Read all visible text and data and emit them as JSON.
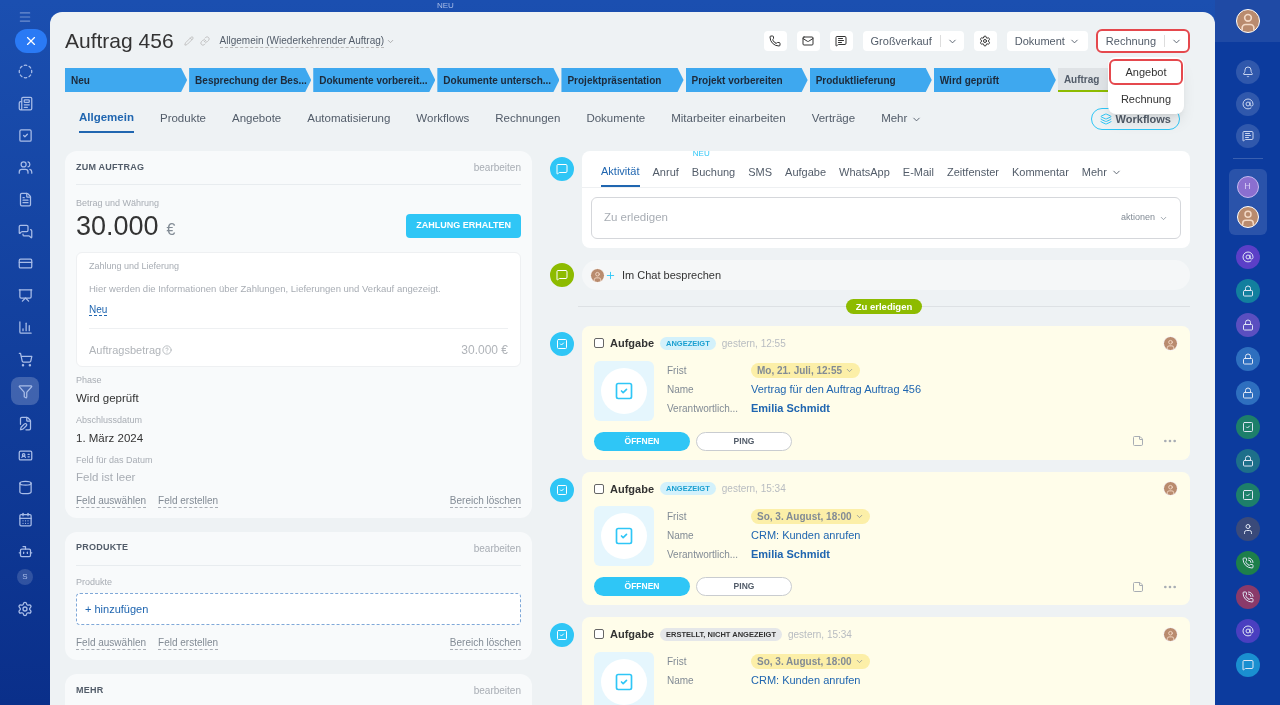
{
  "top_badge": "NEU",
  "left_nav": {
    "items": [
      {
        "selected": false
      },
      {
        "selected": false
      },
      {
        "selected": false
      },
      {
        "selected": false
      },
      {
        "selected": false
      },
      {
        "selected": false
      },
      {
        "selected": false
      },
      {
        "selected": false
      },
      {
        "selected": false
      },
      {
        "selected": false
      },
      {
        "selected": true
      },
      {
        "selected": false
      },
      {
        "selected": false
      },
      {
        "selected": false
      },
      {
        "selected": false
      },
      {
        "selected": false
      }
    ],
    "user_letter": "S"
  },
  "header": {
    "title": "Auftrag 456",
    "pipeline": "Allgemein (Wiederkehrender Auftrag)",
    "buttons": [
      {
        "kind": "phone"
      },
      {
        "kind": "mail"
      },
      {
        "kind": "chat"
      },
      {
        "kind": "split",
        "label": "Großverkauf",
        "highlighted": false
      },
      {
        "kind": "gear"
      },
      {
        "kind": "menu",
        "label": "Dokument",
        "highlighted": false
      },
      {
        "kind": "split",
        "label": "Rechnung",
        "highlighted": true
      }
    ]
  },
  "dropdown": {
    "items": [
      {
        "label": "Angebot",
        "highlighted": true
      },
      {
        "label": "Rechnung",
        "highlighted": false
      }
    ]
  },
  "stages": [
    {
      "label": "Neu",
      "active": true
    },
    {
      "label": "Besprechung der Bes...",
      "active": true
    },
    {
      "label": "Dokumente vorbereit...",
      "active": true
    },
    {
      "label": "Dokumente untersch...",
      "active": true
    },
    {
      "label": "Projektpräsentation",
      "active": true
    },
    {
      "label": "Projekt vorbereiten",
      "active": true
    },
    {
      "label": "Produktlieferung",
      "active": true
    },
    {
      "label": "Wird geprüft",
      "active": true
    },
    {
      "label": "Auftrag",
      "active": false
    }
  ],
  "tabs": [
    {
      "label": "Allgemein",
      "selected": true
    },
    {
      "label": "Produkte",
      "selected": false
    },
    {
      "label": "Angebote",
      "selected": false
    },
    {
      "label": "Automatisierung",
      "selected": false
    },
    {
      "label": "Workflows",
      "selected": false
    },
    {
      "label": "Rechnungen",
      "selected": false
    },
    {
      "label": "Dokumente",
      "selected": false
    },
    {
      "label": "Mitarbeiter einarbeiten",
      "selected": false
    },
    {
      "label": "Verträge",
      "selected": false
    },
    {
      "label": "Mehr",
      "selected": false
    }
  ],
  "workflows_button": "Workflows",
  "order_card": {
    "title": "ZUM AUFTRAG",
    "edit": "bearbeiten",
    "amount_label": "Betrag und Währung",
    "amount": "30.000",
    "currency": "€",
    "pay_button": "ZAHLUNG ERHALTEN",
    "payment_box": {
      "title": "Zahlung und Lieferung",
      "text": "Hier werden die Informationen über Zahlungen, Lieferungen und Verkauf angezeigt.",
      "link": "Neu",
      "total_label": "Auftragsbetrag",
      "total": "30.000 €"
    },
    "fields": [
      {
        "label": "Phase",
        "value": "Wird geprüft",
        "kind": "value"
      },
      {
        "label": "Abschlussdatum",
        "value": "1. März 2024",
        "kind": "value"
      },
      {
        "label": "Feld für das Datum",
        "value": "Feld ist leer",
        "kind": "empty"
      }
    ],
    "actions": [
      "Feld auswählen",
      "Feld erstellen"
    ],
    "clear": "Bereich löschen"
  },
  "products_card": {
    "title": "PRODUKTE",
    "edit": "bearbeiten",
    "label": "Produkte",
    "add": "+ hinzufügen",
    "actions": [
      "Feld auswählen",
      "Feld erstellen"
    ],
    "clear": "Bereich löschen"
  },
  "more_card": {
    "title": "MEHR",
    "edit": "bearbeiten"
  },
  "composer": {
    "tabs": [
      {
        "label": "Aktivität",
        "selected": true
      },
      {
        "label": "Anruf",
        "selected": false
      },
      {
        "label": "Buchung",
        "selected": false,
        "badge": "NEU"
      },
      {
        "label": "SMS",
        "selected": false
      },
      {
        "label": "Aufgabe",
        "selected": false
      },
      {
        "label": "WhatsApp",
        "selected": false
      },
      {
        "label": "E-Mail",
        "selected": false
      },
      {
        "label": "Zeitfenster",
        "selected": false
      },
      {
        "label": "Kommentar",
        "selected": false
      },
      {
        "label": "Mehr",
        "selected": false
      }
    ],
    "placeholder": "Zu erledigen",
    "actions": "aktionen"
  },
  "chat": {
    "label": "Im Chat besprechen"
  },
  "divider_badge": "Zu erledigen",
  "tasks": [
    {
      "title": "Aufgabe",
      "checked": false,
      "status": {
        "label": "ANGEZEIGT",
        "color": "#d3f1fb"
      },
      "time": "gestern, 12:55",
      "fields": [
        {
          "label": "Frist",
          "value": "Mo, 21. Juli, 12:55",
          "kind": "date"
        },
        {
          "label": "Name",
          "value": "Vertrag für den Auftrag Auftrag 456",
          "kind": "link"
        },
        {
          "label": "Verantwortlich...",
          "value": "Emilia Schmidt",
          "kind": "person"
        }
      ],
      "buttons": [
        "ÖFFNEN",
        "PING"
      ]
    },
    {
      "title": "Aufgabe",
      "checked": false,
      "status": {
        "label": "ANGEZEIGT",
        "color": "#d3f1fb"
      },
      "time": "gestern, 15:34",
      "fields": [
        {
          "label": "Frist",
          "value": "So, 3. August, 18:00",
          "kind": "date"
        },
        {
          "label": "Name",
          "value": "CRM: Kunden anrufen",
          "kind": "link"
        },
        {
          "label": "Verantwortlich...",
          "value": "Emilia Schmidt",
          "kind": "person"
        }
      ],
      "buttons": [
        "ÖFFNEN",
        "PING"
      ]
    },
    {
      "title": "Aufgabe",
      "checked": false,
      "status": {
        "label": "ERSTELLT, NICHT ANGEZEIGT",
        "color": "#e5e7e9"
      },
      "time": "gestern, 15:34",
      "fields": [
        {
          "label": "Frist",
          "value": "So, 3. August, 18:00",
          "kind": "date"
        },
        {
          "label": "Name",
          "value": "CRM: Kunden anrufen",
          "kind": "link"
        }
      ]
    }
  ],
  "right_bar": {
    "group_letter": "H"
  }
}
